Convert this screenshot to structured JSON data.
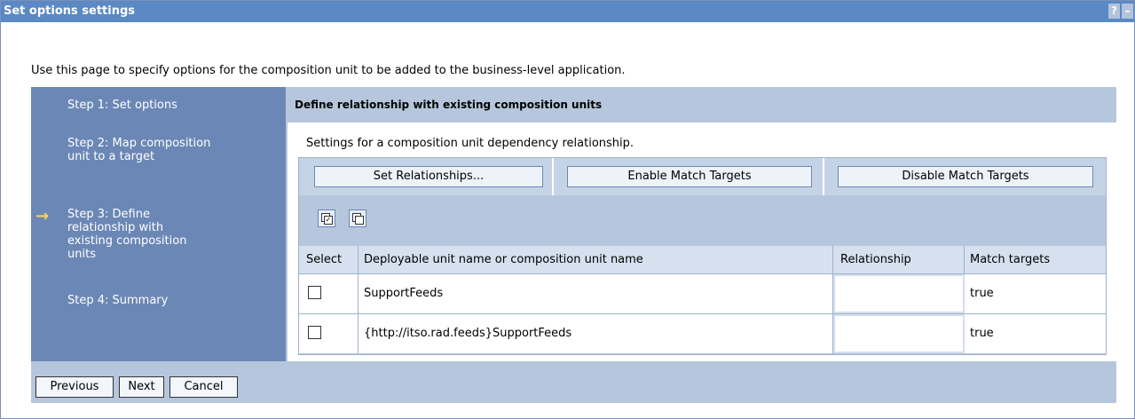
{
  "window": {
    "title": "Set options settings",
    "help_label": "?",
    "minimize_label": "–"
  },
  "intro": "Use this page to specify options for the composition unit to be added to the business-level application.",
  "steps": [
    {
      "label": "Step 1: Set options"
    },
    {
      "label": "Step 2: Map composition unit to a target"
    },
    {
      "label": "Step 3: Define relationship with existing composition units",
      "current": true
    },
    {
      "label": "Step 4: Summary"
    }
  ],
  "current_arrow": "→",
  "content": {
    "header": "Define relationship with existing composition units",
    "settings_text": "Settings for a composition unit dependency relationship.",
    "buttons": {
      "set_relationships": "Set Relationships...",
      "enable_match": "Enable Match Targets",
      "disable_match": "Disable Match Targets"
    },
    "icons": [
      "select-all-icon",
      "deselect-all-icon"
    ],
    "table": {
      "columns": [
        "Select",
        "Deployable unit name or composition unit name",
        "Relationship",
        "Match targets"
      ],
      "rows": [
        {
          "name": "SupportFeeds",
          "relationship": "",
          "match_targets": "true"
        },
        {
          "name": "{http://itso.rad.feeds}SupportFeeds",
          "relationship": "",
          "match_targets": "true"
        }
      ]
    }
  },
  "footer": {
    "previous": "Previous",
    "next": "Next",
    "cancel": "Cancel"
  }
}
